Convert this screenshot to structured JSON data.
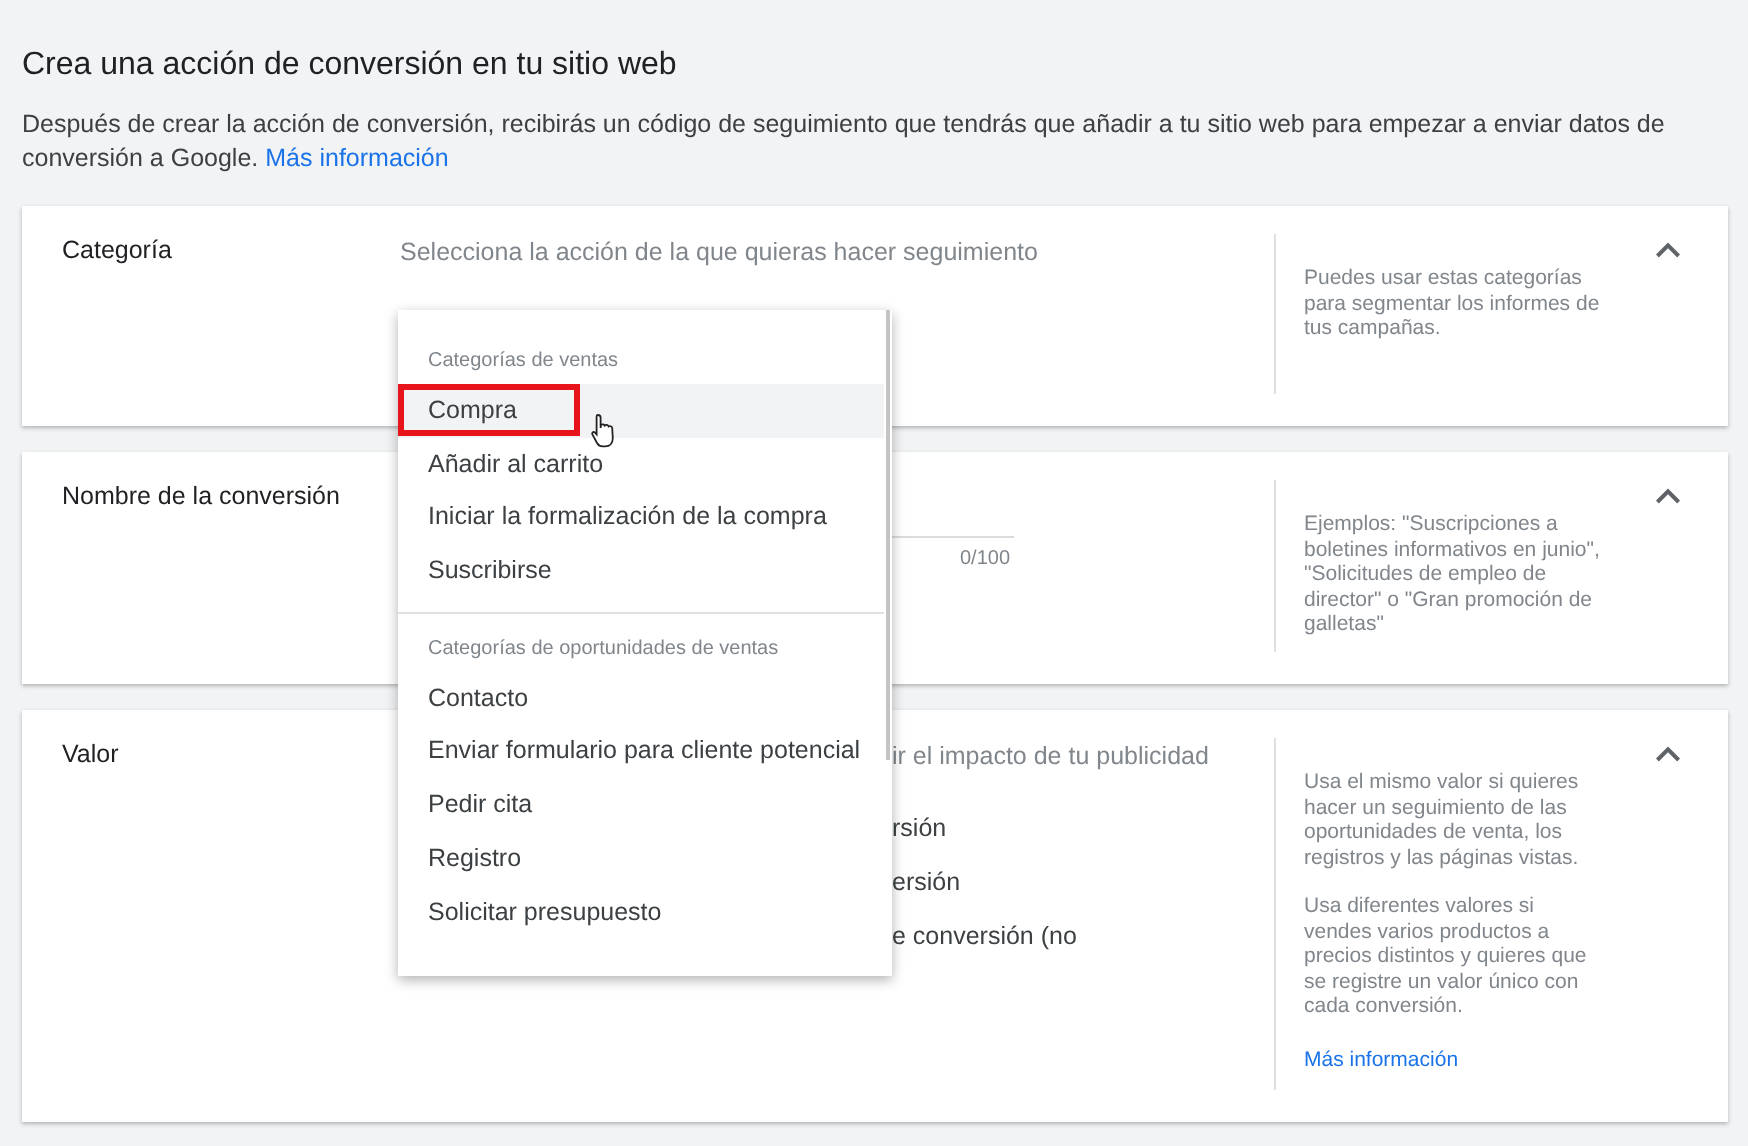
{
  "title": "Crea una acción de conversión en tu sitio web",
  "description": {
    "text": "Después de crear la acción de conversión, recibirás un código de seguimiento que tendrás que añadir a tu sitio web para empezar a enviar datos de conversión a Google.",
    "link": "Más información"
  },
  "sections": [
    {
      "kind": "category",
      "label": "Categoría",
      "placeholder": "Selecciona la acción de la que quieras hacer seguimiento",
      "help": [
        "Puedes usar estas categorías para segmentar los informes de tus campañas."
      ],
      "expanded": true
    },
    {
      "kind": "name",
      "label": "Nombre de la conversión",
      "counter": "0/100",
      "help": [
        "Ejemplos: \"Suscripciones a boletines informativos en junio\", \"Solicitudes de empleo de director\" o \"Gran promoción de galletas\""
      ],
      "expanded": true
    },
    {
      "kind": "value",
      "label": "Valor",
      "partial_texts": [
        "ir el impacto de tu publicidad",
        "rsión",
        "ersión",
        "e conversión (no"
      ],
      "help": [
        "Usa el mismo valor si quieres hacer un seguimiento de las oportunidades de venta, los registros y las páginas vistas.",
        "Usa diferentes valores si vendes varios productos a precios distintos y quieres que se registre un valor único con cada conversión."
      ],
      "help_link": "Más información",
      "expanded": true
    }
  ],
  "menu": {
    "groups": [
      {
        "header": "Categorías de ventas",
        "items": [
          {
            "label": "Compra",
            "selected": true,
            "boxed": true
          },
          {
            "label": "Añadir al carrito",
            "selected": false,
            "boxed": false
          },
          {
            "label": "Iniciar la formalización de la compra",
            "selected": false,
            "boxed": false
          },
          {
            "label": "Suscribirse",
            "selected": false,
            "boxed": false
          }
        ]
      },
      {
        "header": "Categorías de oportunidades de ventas",
        "items": [
          {
            "label": "Contacto",
            "selected": false,
            "boxed": false
          },
          {
            "label": "Enviar formulario para cliente potencial",
            "selected": false,
            "boxed": false
          },
          {
            "label": "Pedir cita",
            "selected": false,
            "boxed": false
          },
          {
            "label": "Registro",
            "selected": false,
            "boxed": false
          },
          {
            "label": "Solicitar presupuesto",
            "selected": false,
            "boxed": false
          }
        ]
      }
    ]
  }
}
